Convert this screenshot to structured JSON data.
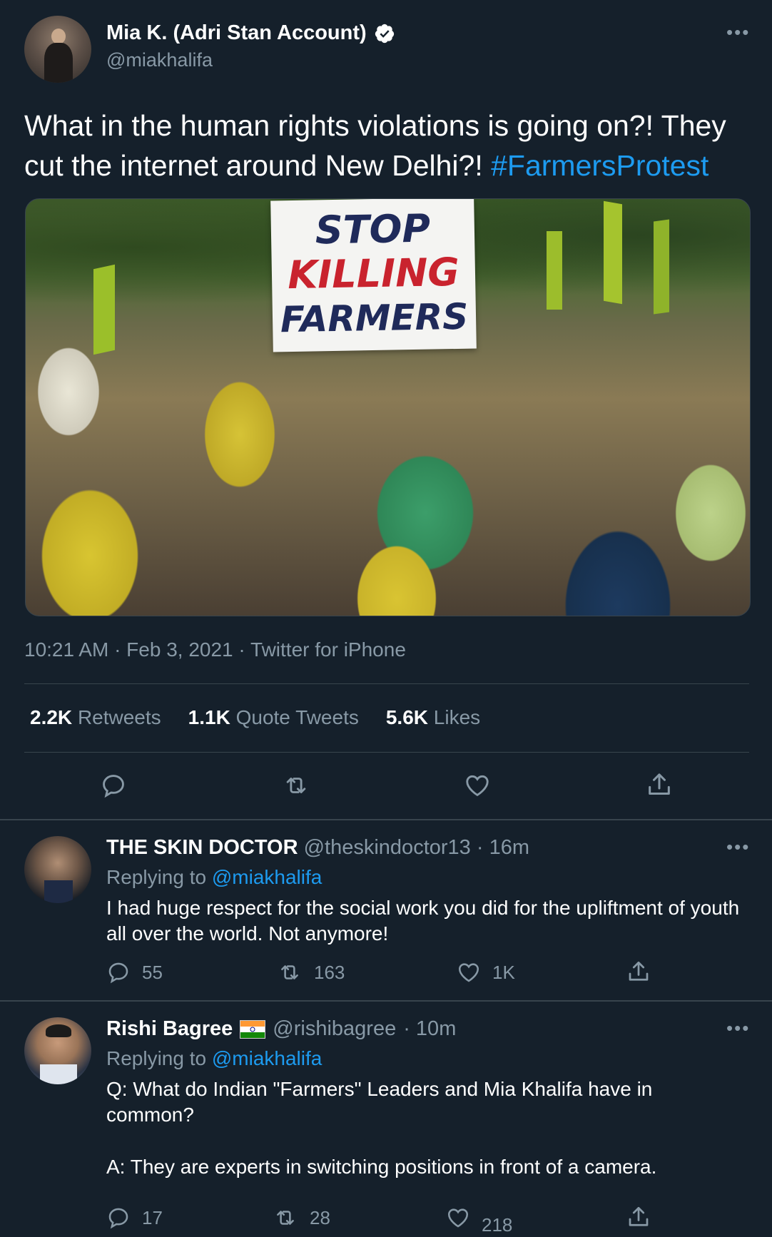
{
  "main_tweet": {
    "display_name": "Mia K. (Adri Stan Account)",
    "handle": "@miakhalifa",
    "text": "What in the human rights violations is going on?! They cut the internet around New Delhi?! ",
    "hashtag": "#FarmersProtest",
    "image": {
      "sign_line1": "STOP",
      "sign_line2": "KILLING",
      "sign_line3": "FARMERS"
    },
    "meta": "10:21 AM · Feb 3, 2021 · Twitter for iPhone",
    "stats": {
      "retweets_count": "2.2K",
      "retweets_label": "Retweets",
      "quotes_count": "1.1K",
      "quotes_label": "Quote Tweets",
      "likes_count": "5.6K",
      "likes_label": "Likes"
    },
    "actions": [
      "reply-icon",
      "retweet-icon",
      "like-icon",
      "share-icon"
    ]
  },
  "replies": [
    {
      "display_name": "THE SKIN DOCTOR",
      "handle": "@theskindoctor13",
      "time": "· 16m",
      "replying_prefix": "Replying to ",
      "replying_to": "@miakhalifa",
      "text": "I had huge respect for the social work you did for the upliftment of youth all over the world. Not anymore!",
      "replies": "55",
      "retweets": "163",
      "likes": "1K"
    },
    {
      "display_name": "Rishi Bagree",
      "flag": "india-flag",
      "handle": "@rishibagree",
      "time": "· 10m",
      "replying_prefix": "Replying to ",
      "replying_to": "@miakhalifa",
      "text_q": "Q: What do Indian \"Farmers\" Leaders and Mia Khalifa have in common?",
      "text_a": "A: They are experts in switching positions in front of a camera.",
      "replies": "17",
      "retweets": "28",
      "likes": "218"
    }
  ],
  "colors": {
    "background": "#15202b",
    "divider": "#38444d",
    "muted": "#8899a6",
    "link": "#1d9bf0",
    "verified": "#ffffff"
  }
}
